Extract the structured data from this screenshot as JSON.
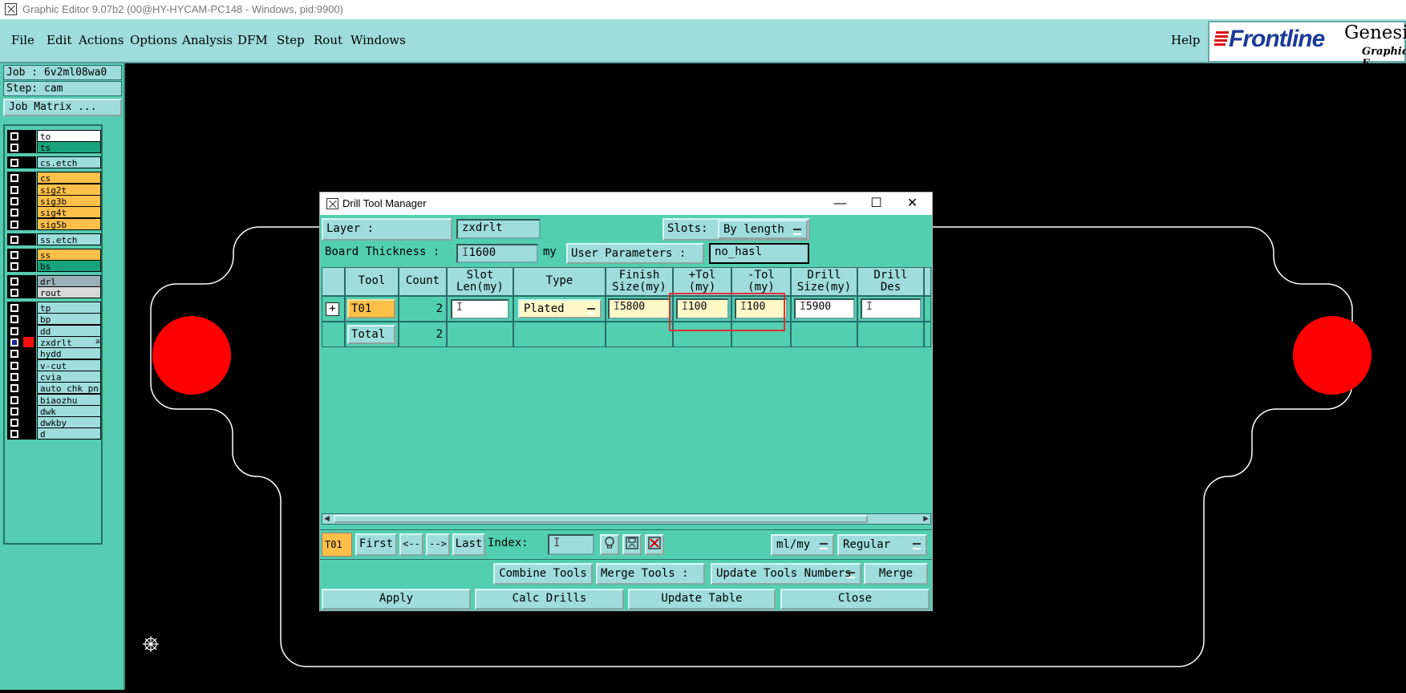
{
  "window": {
    "title": "Graphic Editor 9.07b2 (00@HY-HYCAM-PC148 - Windows, pid:9900)"
  },
  "menu": {
    "items": [
      "File",
      "Edit",
      "Actions",
      "Options",
      "Analysis",
      "DFM",
      "Step",
      "Rout",
      "Windows"
    ],
    "help": "Help"
  },
  "logo": {
    "brand": "Frontline",
    "product": "Genesis",
    "subtitle": "Graphic E"
  },
  "left_panel": {
    "job": "Job : 6v2ml08wa0",
    "step": "Step: cam",
    "job_matrix": "Job Matrix ...",
    "layers": [
      {
        "name": "to",
        "color": "#ffffff"
      },
      {
        "name": "ts",
        "color": "#19a37a"
      },
      {
        "name": "cs.etch",
        "color": "#9fdcdc"
      },
      {
        "name": "cs",
        "color": "#ffc04a"
      },
      {
        "name": "sig2t",
        "color": "#ffc04a"
      },
      {
        "name": "sig3b",
        "color": "#ffc04a"
      },
      {
        "name": "sig4t",
        "color": "#ffc04a"
      },
      {
        "name": "sig5b",
        "color": "#ffc04a"
      },
      {
        "name": "ss.etch",
        "color": "#9fdcdc"
      },
      {
        "name": "ss",
        "color": "#ffc04a"
      },
      {
        "name": "bs",
        "color": "#19a37a"
      },
      {
        "name": "drl",
        "color": "#9ab0b8"
      },
      {
        "name": "rout",
        "color": "#d8d8d8"
      },
      {
        "name": "tp",
        "color": "#9fdcdc"
      },
      {
        "name": "bp",
        "color": "#9fdcdc"
      },
      {
        "name": "dd",
        "color": "#9fdcdc"
      },
      {
        "name": "zxdrlt",
        "color": "#9fdcdc"
      },
      {
        "name": "hydd",
        "color": "#9fdcdc"
      },
      {
        "name": "v-cut",
        "color": "#9fdcdc"
      },
      {
        "name": "cvia",
        "color": "#9fdcdc"
      },
      {
        "name": "auto_chk_pn",
        "color": "#9fdcdc"
      },
      {
        "name": "biaozhu",
        "color": "#9fdcdc"
      },
      {
        "name": "dwk",
        "color": "#9fdcdc"
      },
      {
        "name": "dwkby",
        "color": "#9fdcdc"
      },
      {
        "name": "d",
        "color": "#9fdcdc"
      }
    ],
    "active_layer_marker": "a"
  },
  "dialog": {
    "title": "Drill Tool Manager",
    "layer_label": "Layer           :",
    "layer_value": "zxdrlt",
    "slots_label": "Slots:",
    "slots_value": "By length",
    "board_thickness_label": "Board Thickness :",
    "board_thickness_value": "1600",
    "board_thickness_unit": "my",
    "user_params_label": "User Parameters :",
    "user_params_value": "no_hasl",
    "columns": [
      {
        "l1": "Tool",
        "l2": ""
      },
      {
        "l1": "Count",
        "l2": ""
      },
      {
        "l1": "Slot",
        "l2": "Len(my)"
      },
      {
        "l1": "Type",
        "l2": ""
      },
      {
        "l1": "Finish",
        "l2": "Size(my)"
      },
      {
        "l1": "+Tol",
        "l2": "(my)"
      },
      {
        "l1": "-Tol",
        "l2": "(my)"
      },
      {
        "l1": "Drill",
        "l2": "Size(my)"
      },
      {
        "l1": "Drill",
        "l2": "Des"
      }
    ],
    "row": {
      "tool": "T01",
      "count": "2",
      "slot_len": "",
      "type": "Plated",
      "finish_size": "5800",
      "plus_tol": "100",
      "minus_tol": "100",
      "drill_size": "5900",
      "drill_des": ""
    },
    "total": {
      "label": "Total",
      "count": "2"
    },
    "nav": {
      "current_tool": "T01",
      "first": "First",
      "prev": "<--",
      "next": "-->",
      "last": "Last",
      "index_label": "Index:",
      "index_value": "",
      "units": "ml/my",
      "mode": "Regular"
    },
    "tools_row": {
      "combine": "Combine Tools",
      "merge_label": "Merge Tools :",
      "merge_option": "Update Tools Numbers",
      "merge": "Merge"
    },
    "actions": {
      "apply": "Apply",
      "calc": "Calc Drills",
      "update": "Update Table",
      "close": "Close"
    },
    "highlight_color": "#e03030"
  },
  "canvas": {
    "outline_color": "#ffffff",
    "pad_color": "#ff0000"
  }
}
